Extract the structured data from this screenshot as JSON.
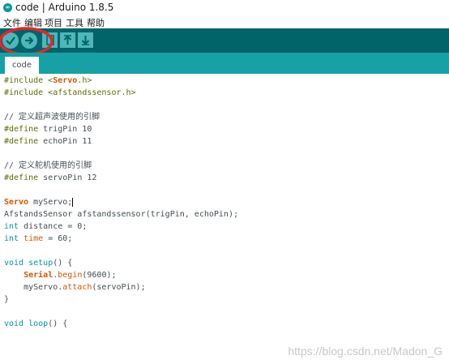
{
  "window": {
    "title": "code | Arduino 1.8.5",
    "logo_text": "∞"
  },
  "menu": [
    "文件",
    "编辑",
    "项目",
    "工具",
    "帮助"
  ],
  "toolbar": {
    "buttons": [
      {
        "name": "verify-button",
        "icon": "check-icon"
      },
      {
        "name": "upload-button",
        "icon": "arrow-right-icon"
      },
      {
        "name": "new-button",
        "icon": "new-file-icon"
      },
      {
        "name": "open-button",
        "icon": "arrow-up-icon"
      },
      {
        "name": "save-button",
        "icon": "arrow-down-icon"
      }
    ],
    "colors": {
      "bar": "#006468",
      "button": "#4db7bb",
      "annotation": "#e8242b"
    }
  },
  "tabs": [
    {
      "label": "code"
    }
  ],
  "code": {
    "l1a": "#include <",
    "l1b": "Servo",
    "l1c": ".h>",
    "l2": "#include <afstandssensor.h>",
    "l4": "// 定义超声波使用的引脚",
    "l5a": "#define",
    "l5b": " trigPin 10",
    "l6a": "#define",
    "l6b": " echoPin 11",
    "l8": "// 定义舵机使用的引脚",
    "l9a": "#define",
    "l9b": " servoPin 12",
    "l11a": "Servo",
    "l11b": " myServo;",
    "l12": "AfstandsSensor afstandssensor(trigPin, echoPin);",
    "l13a": "int",
    "l13b": " distance = 0;",
    "l14a": "int",
    "l14b": " time",
    "l14c": " = 60;",
    "l16a": "void",
    "l16b": " setup",
    "l16c": "() {",
    "l17a": "    ",
    "l17b": "Serial",
    "l17c": ".",
    "l17d": "begin",
    "l17e": "(9600);",
    "l18a": "    myServo.",
    "l18b": "attach",
    "l18c": "(servoPin);",
    "l19": "}",
    "l21a": "void",
    "l21b": " loop",
    "l21c": "() {"
  },
  "watermark": "https://blog.csdn.net/Madon_G"
}
